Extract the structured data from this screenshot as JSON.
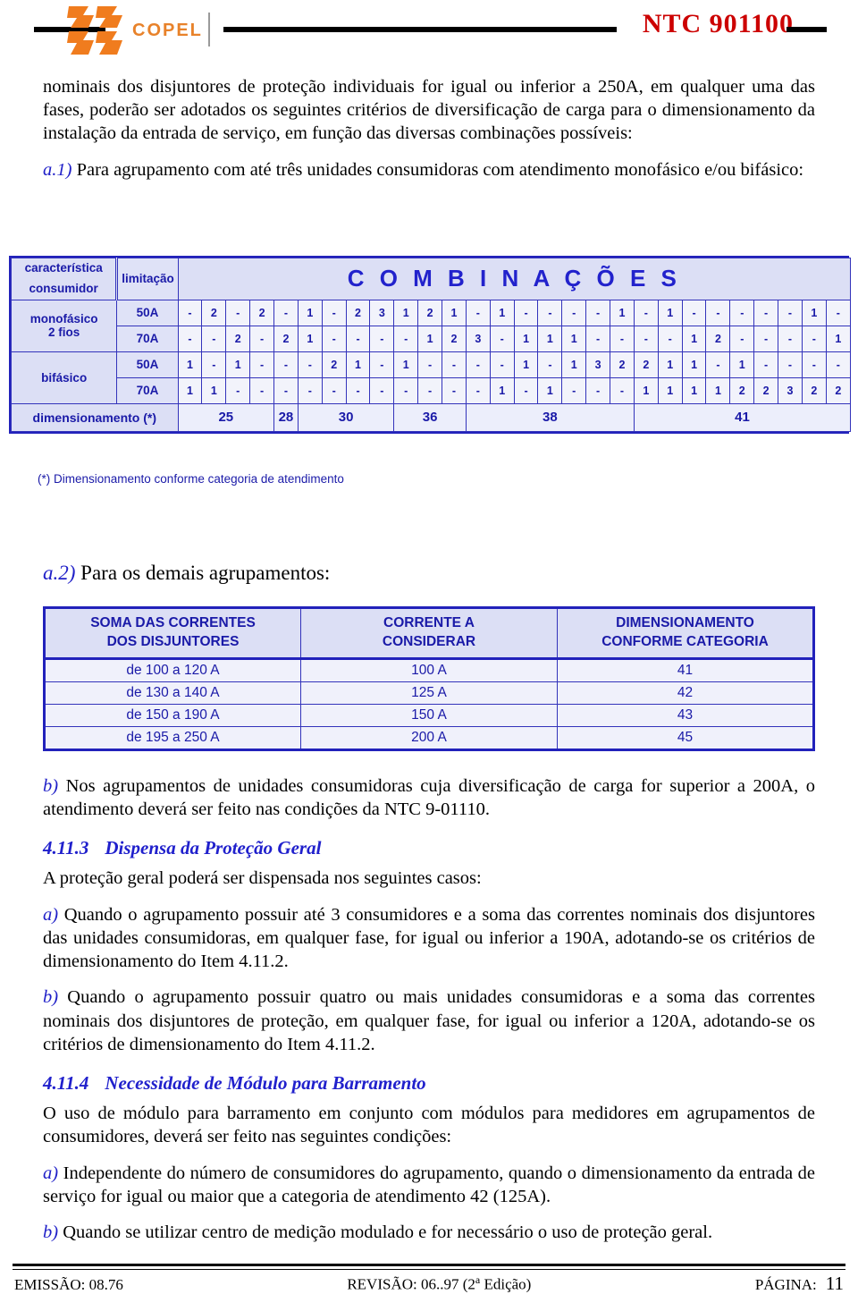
{
  "header": {
    "logo_text": "COPEL",
    "doc_code": "NTC 901100"
  },
  "intro": {
    "paragraph": "nominais dos disjuntores de proteção individuais for igual ou inferior a 250A, em qualquer uma das fases, poderão ser adotados os seguintes critérios de diversificação de carga para o dimensionamento da instalação da entrada de serviço, em função das diversas combinações possíveis:",
    "a1_marker": "a.1)",
    "a1_text": " Para agrupamento com até três unidades consumidoras com atendimento monofásico e/ou bifásico:"
  },
  "table1": {
    "char_head_line1": "característica",
    "char_head_line2": "consumidor",
    "limit_head": "limitação",
    "comb_head": "C O M B I N A Ç Õ E S",
    "row_groups": [
      {
        "label_line1": "monofásico",
        "label_line2": "2 fios"
      },
      {
        "label_line1": "bifásico",
        "label_line2": ""
      }
    ],
    "rows": [
      {
        "group": "monofásico 2 fios",
        "limit": "50A",
        "values": [
          "-",
          "2",
          "-",
          "2",
          "-",
          "1",
          "-",
          "2",
          "3",
          "1",
          "2",
          "1",
          "-",
          "1",
          "-",
          "-",
          "-",
          "-",
          "1",
          "-",
          "1",
          "-",
          "-",
          "-",
          "-",
          "-",
          "1",
          "-"
        ]
      },
      {
        "group": "monofásico 2 fios",
        "limit": "70A",
        "values": [
          "-",
          "-",
          "2",
          "-",
          "2",
          "1",
          "-",
          "-",
          "-",
          "-",
          "1",
          "2",
          "3",
          "-",
          "1",
          "1",
          "1",
          "-",
          "-",
          "-",
          "-",
          "1",
          "2",
          "-",
          "-",
          "-",
          "-",
          "1"
        ]
      },
      {
        "group": "bifásico",
        "limit": "50A",
        "values": [
          "1",
          "-",
          "1",
          "-",
          "-",
          "-",
          "2",
          "1",
          "-",
          "1",
          "-",
          "-",
          "-",
          "-",
          "1",
          "-",
          "1",
          "3",
          "2",
          "2",
          "1",
          "1",
          "-",
          "1",
          "-",
          "-",
          "-",
          "-"
        ]
      },
      {
        "group": "bifásico",
        "limit": "70A",
        "values": [
          "1",
          "1",
          "-",
          "-",
          "-",
          "-",
          "-",
          "-",
          "-",
          "-",
          "-",
          "-",
          "-",
          "1",
          "-",
          "1",
          "-",
          "-",
          "-",
          "1",
          "1",
          "1",
          "1",
          "2",
          "2",
          "3",
          "2",
          "2"
        ]
      }
    ],
    "dim_label": "dimensionamento (*)",
    "dim_groups": [
      {
        "value": "25",
        "span": 4
      },
      {
        "value": "28",
        "span": 1
      },
      {
        "value": "30",
        "span": 4
      },
      {
        "value": "36",
        "span": 3
      },
      {
        "value": "38",
        "span": 7
      },
      {
        "value": "41",
        "span": 9
      }
    ],
    "footnote": "(*) Dimensionamento conforme categoria de atendimento"
  },
  "a2": {
    "marker": "a.2)",
    "text": " Para os demais agrupamentos:"
  },
  "table2": {
    "headers": [
      "SOMA DAS CORRENTES\nDOS DISJUNTORES",
      "CORRENTE A\nCONSIDERAR",
      "DIMENSIONAMENTO\nCONFORME CATEGORIA"
    ],
    "header_lines": [
      [
        "SOMA DAS CORRENTES",
        "DOS DISJUNTORES"
      ],
      [
        "CORRENTE A",
        "CONSIDERAR"
      ],
      [
        "DIMENSIONAMENTO",
        "CONFORME CATEGORIA"
      ]
    ],
    "rows": [
      [
        "de 100 a 120 A",
        "100 A",
        "41"
      ],
      [
        "de 130 a 140 A",
        "125 A",
        "42"
      ],
      [
        "de 150 a 190 A",
        "150 A",
        "43"
      ],
      [
        "de 195 a 250 A",
        "200 A",
        "45"
      ]
    ]
  },
  "body": {
    "b_marker": "b)",
    "b_text": " Nos agrupamentos de unidades consumidoras cuja diversificação de carga for superior a 200A, o atendimento deverá ser feito nas condições da NTC 9-01110.",
    "sec_4113_num": "4.11.3",
    "sec_4113_title": "Dispensa da Proteção Geral",
    "intro_4113": "A proteção geral poderá ser dispensada nos seguintes casos:",
    "a_marker": "a)",
    "a_text": " Quando o agrupamento possuir até 3 consumidores e a soma das correntes nominais dos disjuntores das unidades consumidoras, em qualquer fase, for igual ou inferior a 190A, adotando-se os critérios de dimensionamento do Item 4.11.2.",
    "b2_marker": "b)",
    "b2_text": " Quando o agrupamento possuir quatro ou mais unidades consumidoras e a soma das correntes nominais dos disjuntores de proteção, em qualquer fase, for igual ou inferior a 120A, adotando-se os critérios de dimensionamento do Item 4.11.2.",
    "sec_4114_num": "4.11.4",
    "sec_4114_title": "Necessidade de Módulo para Barramento",
    "intro_4114": "O uso de módulo para barramento em conjunto com módulos para medidores em agrupamentos de consumidores, deverá ser feito nas seguintes condições:",
    "a2_marker": "a)",
    "a2_text": " Independente do número de consumidores do agrupamento, quando o dimensionamento da entrada de serviço for igual ou maior que a categoria de atendimento 42 (125A).",
    "b3_marker": "b)",
    "b3_text": " Quando se utilizar centro de medição modulado e for necessário o uso de proteção geral."
  },
  "footer": {
    "emission": "EMISSÃO: 08.76",
    "revision_prefix": "REVISÃO: 06..97 (2",
    "revision_sup": "a",
    "revision_suffix": " Edição)",
    "page_label": "PÁGINA:",
    "page_number": "11"
  },
  "colors": {
    "brand_orange": "#e8822a",
    "doc_code_red": "#cc0000",
    "table_blue": "#1a1aa8",
    "table_border": "#3333bb",
    "table_header_bg": "#dcdff5",
    "table_cell_bg": "#f2f3fb"
  }
}
